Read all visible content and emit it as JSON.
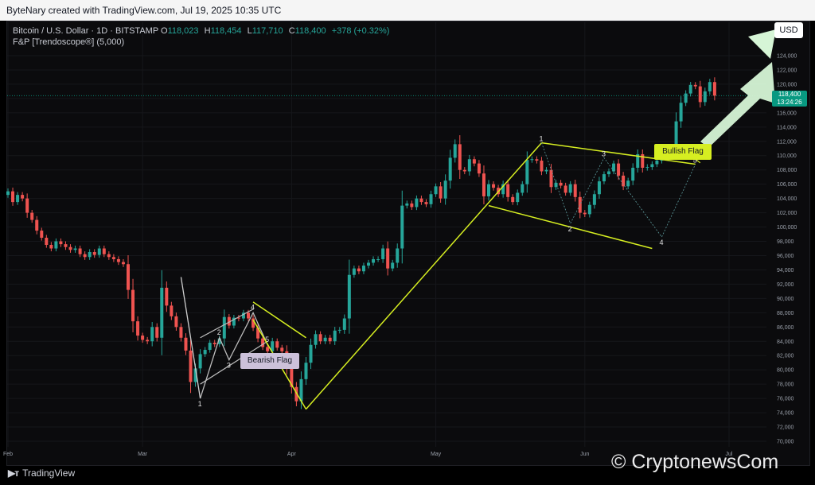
{
  "header": {
    "title": "ByteNary created with TradingView.com, Jul 19, 2025 10:35 UTC"
  },
  "legend": {
    "symbol": "Bitcoin / U.S. Dollar · 1D · BITSTAMP",
    "open_label": "O",
    "open": "118,023",
    "high_label": "H",
    "high": "118,454",
    "low_label": "L",
    "low": "117,710",
    "close_label": "C",
    "close": "118,400",
    "change": "+378 (+0.32%)",
    "indicator": "F&P [Trendoscope®] (5,000)"
  },
  "currency_button": "USD",
  "price_tag": {
    "price": "118,400",
    "countdown": "13:24:26"
  },
  "pattern_labels": {
    "bearish": "Bearish Flag",
    "bullish": "Bullish Flag"
  },
  "footer": {
    "brand": "TradingView",
    "watermark": "CryptonewsCom"
  },
  "colors": {
    "up": "#26a69a",
    "down": "#ef5350",
    "pattern_yellow": "#d6ee21",
    "pattern_gray": "#bdbdbd",
    "arrow": "#d6f5d6",
    "background": "#0b0b0d"
  },
  "chart_data": {
    "type": "candlestick",
    "ylim": [
      69000,
      125000
    ],
    "y_ticks": [
      70000,
      72000,
      74000,
      76000,
      78000,
      80000,
      82000,
      84000,
      86000,
      88000,
      90000,
      92000,
      94000,
      96000,
      98000,
      100000,
      102000,
      104000,
      106000,
      108000,
      110000,
      112000,
      114000,
      116000,
      118000,
      120000,
      122000,
      124000
    ],
    "y_tick_labels": [
      "70,000",
      "72,000",
      "74,000",
      "76,000",
      "78,000",
      "80,000",
      "82,000",
      "84,000",
      "86,000",
      "88,000",
      "90,000",
      "92,000",
      "94,000",
      "96,000",
      "98,000",
      "100,000",
      "102,000",
      "104,000",
      "106,000",
      "108,000",
      "110,000",
      "112,000",
      "114,000",
      "116,000",
      "118,000",
      "120,000",
      "122,000",
      "124,000"
    ],
    "x_labels": [
      {
        "label": "Feb",
        "day": 0
      },
      {
        "label": "Mar",
        "day": 28
      },
      {
        "label": "Apr",
        "day": 59
      },
      {
        "label": "May",
        "day": 89
      },
      {
        "label": "Jun",
        "day": 120
      },
      {
        "label": "Jul",
        "day": 150
      }
    ],
    "last_price": 118400,
    "closes": [
      105000,
      103500,
      104500,
      104000,
      102000,
      101000,
      99500,
      98500,
      97500,
      97000,
      98000,
      97600,
      97200,
      96800,
      97000,
      96200,
      95800,
      96500,
      96100,
      97000,
      96200,
      95800,
      95500,
      95100,
      94800,
      91200,
      86800,
      84800,
      84200,
      84000,
      86000,
      84500,
      91500,
      89000,
      87500,
      86000,
      84500,
      82700,
      78300,
      80200,
      82200,
      82800,
      83800,
      83600,
      84400,
      87400,
      86200,
      87300,
      87200,
      88000,
      87200,
      85900,
      84400,
      83200,
      82600,
      84000,
      83100,
      82600,
      80200,
      77600,
      75600,
      78700,
      81000,
      83500,
      85000,
      84000,
      84500,
      84000,
      85500,
      85600,
      87200,
      93300,
      94200,
      93800,
      94600,
      95000,
      95500,
      95500,
      97000,
      94200,
      95000,
      97000,
      103000,
      103300,
      102800,
      104000,
      103500,
      103200,
      104600,
      105700,
      104000,
      106500,
      109700,
      111600,
      108000,
      107800,
      109500,
      108900,
      107500,
      104300,
      106000,
      105500,
      104600,
      106000,
      104200,
      103500,
      104800,
      106000,
      109400,
      109500,
      109300,
      107800,
      108000,
      105600,
      106200,
      105800,
      104800,
      106000,
      104200,
      102000,
      101800,
      103100,
      104600,
      106400,
      107400,
      107800,
      108900,
      107200,
      105700,
      106500,
      108300,
      110200,
      108300,
      108400,
      108800,
      109300,
      109900,
      111000,
      111200,
      114800,
      117400,
      118700,
      119900,
      119700,
      117500,
      119000,
      120300,
      118400
    ],
    "anchor_open": 104500,
    "bearish_flag": {
      "points": [
        {
          "label": "1",
          "day": 40,
          "price": 76000
        },
        {
          "label": "2",
          "day": 44,
          "price": 84500
        },
        {
          "label": "3",
          "day": 46,
          "price": 81400
        },
        {
          "label": "4",
          "day": 51,
          "price": 88000
        },
        {
          "label": "5",
          "day": 54,
          "price": 83500
        }
      ]
    },
    "bullish_flag": {
      "points": [
        {
          "label": "1",
          "day": 111,
          "price": 111800
        },
        {
          "label": "2",
          "day": 117,
          "price": 100500
        },
        {
          "label": "3",
          "day": 124,
          "price": 109700
        },
        {
          "label": "4",
          "day": 136,
          "price": 98600
        },
        {
          "label": "5",
          "day": 143,
          "price": 108800
        }
      ]
    }
  }
}
